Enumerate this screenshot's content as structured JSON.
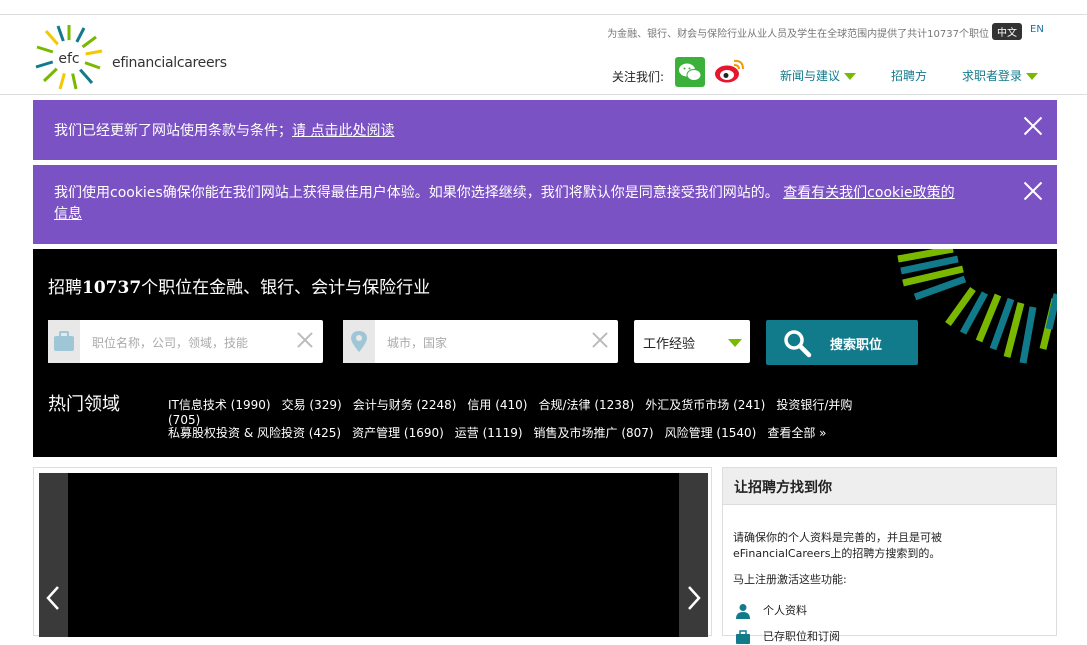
{
  "header": {
    "logo_mark": "efc",
    "logo_text": "efinancialcareers",
    "tagline": "为金融、银行、财会与保险行业从业人员及学生在全球范围内提供了共计10737个职位",
    "lang_zh": "中文",
    "lang_en": "EN",
    "follow_label": "关注我们:",
    "nav": {
      "news": "新闻与建议",
      "recruiters": "招聘方",
      "jobseeker_login": "求职者登录"
    }
  },
  "banners": {
    "terms": {
      "text": "我们已经更新了网站使用条款与条件；",
      "link": "请 点击此处阅读"
    },
    "cookies": {
      "text": "我们使用cookies确保你能在我们网站上获得最佳用户体验。如果你选择继续，我们将默认你是同意接受我们网站的。 ",
      "link_line1": "查看有关我们cookie政策的",
      "link_line2": "信息"
    }
  },
  "search": {
    "title_prefix": "招聘",
    "title_count": "10737",
    "title_suffix": "个职位在金融、银行、会计与保险行业",
    "keyword_placeholder": "职位名称，公司，领域，技能",
    "location_placeholder": "城市，国家",
    "experience_label": "工作经验",
    "button_label": "搜索职位"
  },
  "hot": {
    "title": "热门领域",
    "row1": [
      "IT信息技术 (1990)",
      "交易 (329)",
      "会计与财务 (2248)",
      "信用 (410)",
      "合规/法律 (1238)",
      "外汇及货币市场 (241)",
      "投资银行/并购 (705)"
    ],
    "row2": [
      "私募股权投资 & 风险投资 (425)",
      "资产管理 (1690)",
      "运营 (1119)",
      "销售及市场推广 (807)",
      "风险管理 (1540)",
      "查看全部 »"
    ]
  },
  "side": {
    "title": "让招聘方找到你",
    "para1_line1": "请确保你的个人资料是完善的，并且是可被",
    "para1_line2": "eFinancialCareers上的招聘方搜索到的。",
    "para2": "马上注册激活这些功能:",
    "item1": "个人资料",
    "item2": "已存职位和订阅"
  },
  "colors": {
    "banner": "#7b52c4",
    "teal": "#117a8b",
    "green": "#7ab800"
  }
}
